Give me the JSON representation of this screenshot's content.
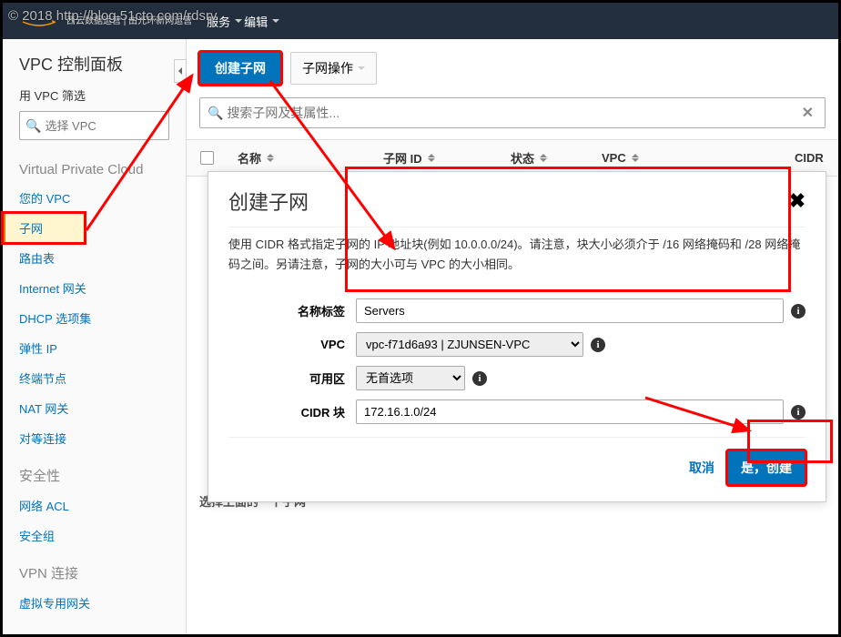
{
  "watermark": "© 2018 http://blog.51cto.com/rdsrv",
  "header": {
    "tagline1": "西云数据运营",
    "tagline2": "由光环新网运营",
    "services": "服务",
    "edit": "编辑"
  },
  "sidebar": {
    "dashboard": "VPC 控制面板",
    "filter_label": "用 VPC 筛选",
    "filter_placeholder": "选择 VPC",
    "sections": {
      "vpc": "Virtual Private Cloud",
      "security": "安全性",
      "vpn": "VPN 连接"
    },
    "items": {
      "your_vpc": "您的 VPC",
      "subnets": "子网",
      "route_tables": "路由表",
      "igw": "Internet 网关",
      "dhcp": "DHCP 选项集",
      "eip": "弹性 IP",
      "endpoints": "终端节点",
      "nat": "NAT 网关",
      "peering": "对等连接",
      "nacl": "网络 ACL",
      "sg": "安全组",
      "vgw": "虚拟专用网关"
    }
  },
  "toolbar": {
    "create": "创建子网",
    "actions": "子网操作"
  },
  "search": {
    "placeholder": "搜索子网及其属性..."
  },
  "table": {
    "col_name": "名称",
    "col_subnet_id": "子网 ID",
    "col_state": "状态",
    "col_vpc": "VPC",
    "col_cidr": "CIDR"
  },
  "select_msg": "选择上面的一个子网",
  "modal": {
    "title": "创建子网",
    "desc": "使用 CIDR 格式指定子网的 IP 地址块(例如 10.0.0.0/24)。请注意，块大小必须介于 /16 网络掩码和 /28 网络掩码之间。另请注意，子网的大小可与 VPC 的大小相同。",
    "name_label": "名称标签",
    "name_value": "Servers",
    "vpc_label": "VPC",
    "vpc_value": "vpc-f71d6a93 | ZJUNSEN-VPC",
    "az_label": "可用区",
    "az_value": "无首选项",
    "cidr_label": "CIDR 块",
    "cidr_value": "172.16.1.0/24",
    "cancel": "取消",
    "confirm": "是，创建"
  }
}
